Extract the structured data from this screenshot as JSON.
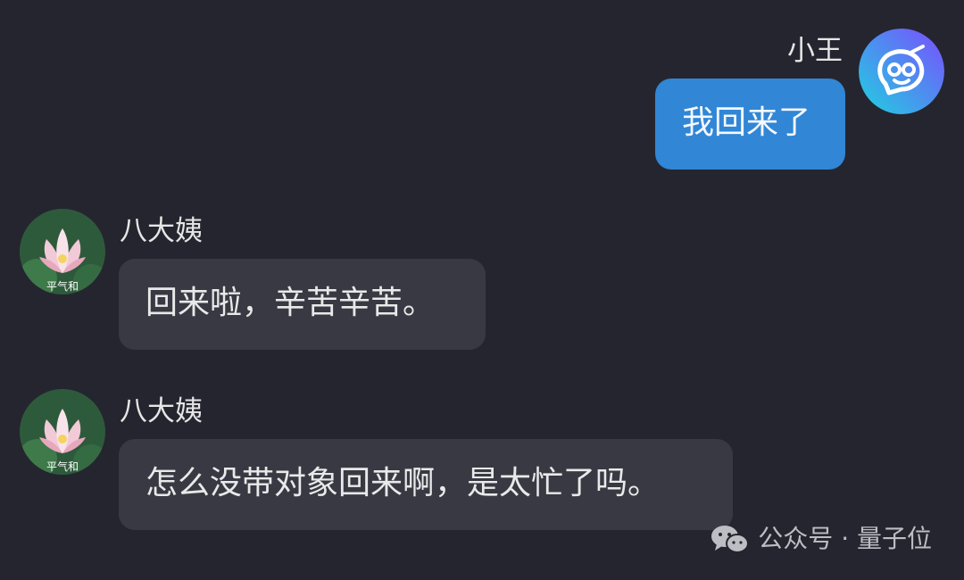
{
  "messages": [
    {
      "sender": "小王",
      "text": "我回来了",
      "side": "right"
    },
    {
      "sender": "八大姨",
      "text": "回来啦，辛苦辛苦。",
      "side": "left"
    },
    {
      "sender": "八大姨",
      "text": "怎么没带对象回来啊，是太忙了吗。",
      "side": "left"
    }
  ],
  "avatars": {
    "self": {
      "icon": "chat-bot-icon",
      "colors": [
        "#1fd1e0",
        "#7b4dff"
      ]
    },
    "other": {
      "icon": "lotus-flower-photo",
      "caption": "平气和"
    }
  },
  "watermark": {
    "icon": "wechat-icon",
    "text": "公众号 · 量子位"
  }
}
